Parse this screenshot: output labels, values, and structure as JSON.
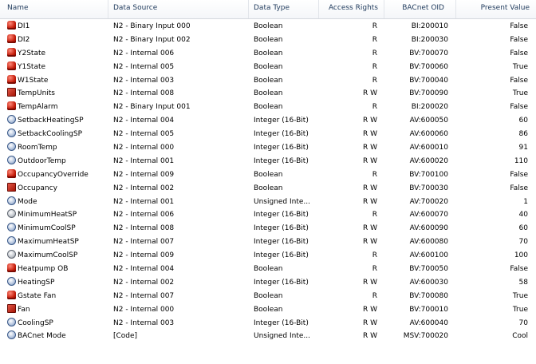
{
  "columns": {
    "name": "Name",
    "data_source": "Data Source",
    "data_type": "Data Type",
    "access_rights": "Access Rights",
    "bacnet_oid": "BACnet OID",
    "present_value": "Present Value"
  },
  "rows": [
    {
      "icon": "boolean-point-icon",
      "name": "DI1",
      "source": "N2 - Binary Input 000",
      "type": "Boolean",
      "access": "R",
      "oid": "BI:200010",
      "value": "False"
    },
    {
      "icon": "boolean-point-icon",
      "name": "DI2",
      "source": "N2 - Binary Input 002",
      "type": "Boolean",
      "access": "R",
      "oid": "BI:200030",
      "value": "False"
    },
    {
      "icon": "boolean-point-icon",
      "name": "Y2State",
      "source": "N2 - Internal 006",
      "type": "Boolean",
      "access": "R",
      "oid": "BV:700070",
      "value": "False"
    },
    {
      "icon": "boolean-point-icon",
      "name": "Y1State",
      "source": "N2 - Internal 005",
      "type": "Boolean",
      "access": "R",
      "oid": "BV:700060",
      "value": "True"
    },
    {
      "icon": "boolean-point-icon",
      "name": "W1State",
      "source": "N2 - Internal 003",
      "type": "Boolean",
      "access": "R",
      "oid": "BV:700040",
      "value": "False"
    },
    {
      "icon": "boolean-writable-icon",
      "name": "TempUnits",
      "source": "N2 - Internal 008",
      "type": "Boolean",
      "access": "RW",
      "oid": "BV:700090",
      "value": "True"
    },
    {
      "icon": "boolean-point-icon",
      "name": "TempAlarm",
      "source": "N2 - Binary Input 001",
      "type": "Boolean",
      "access": "R",
      "oid": "BI:200020",
      "value": "False"
    },
    {
      "icon": "numeric-point-icon",
      "name": "SetbackHeatingSP",
      "source": "N2 - Internal 004",
      "type": "Integer (16-Bit)",
      "access": "RW",
      "oid": "AV:600050",
      "value": "60"
    },
    {
      "icon": "numeric-point-icon",
      "name": "SetbackCoolingSP",
      "source": "N2 - Internal 005",
      "type": "Integer (16-Bit)",
      "access": "RW",
      "oid": "AV:600060",
      "value": "86"
    },
    {
      "icon": "numeric-point-icon",
      "name": "RoomTemp",
      "source": "N2 - Internal 000",
      "type": "Integer (16-Bit)",
      "access": "RW",
      "oid": "AV:600010",
      "value": "91"
    },
    {
      "icon": "numeric-point-icon",
      "name": "OutdoorTemp",
      "source": "N2 - Internal 001",
      "type": "Integer (16-Bit)",
      "access": "RW",
      "oid": "AV:600020",
      "value": "110"
    },
    {
      "icon": "boolean-point-icon",
      "name": "OccupancyOverride",
      "source": "N2 - Internal 009",
      "type": "Boolean",
      "access": "R",
      "oid": "BV:700100",
      "value": "False"
    },
    {
      "icon": "boolean-writable-icon",
      "name": "Occupancy",
      "source": "N2 - Internal 002",
      "type": "Boolean",
      "access": "RW",
      "oid": "BV:700030",
      "value": "False"
    },
    {
      "icon": "numeric-point-icon",
      "name": "Mode",
      "source": "N2 - Internal 001",
      "type": "Unsigned Inte...",
      "access": "RW",
      "oid": "AV:700020",
      "value": "1"
    },
    {
      "icon": "numeric-readonly-icon",
      "name": "MinimumHeatSP",
      "source": "N2 - Internal 006",
      "type": "Integer (16-Bit)",
      "access": "R",
      "oid": "AV:600070",
      "value": "40"
    },
    {
      "icon": "numeric-point-icon",
      "name": "MinimumCoolSP",
      "source": "N2 - Internal 008",
      "type": "Integer (16-Bit)",
      "access": "RW",
      "oid": "AV:600090",
      "value": "60"
    },
    {
      "icon": "numeric-point-icon",
      "name": "MaximumHeatSP",
      "source": "N2 - Internal 007",
      "type": "Integer (16-Bit)",
      "access": "RW",
      "oid": "AV:600080",
      "value": "70"
    },
    {
      "icon": "numeric-readonly-icon",
      "name": "MaximumCoolSP",
      "source": "N2 - Internal 009",
      "type": "Integer (16-Bit)",
      "access": "R",
      "oid": "AV:600100",
      "value": "100"
    },
    {
      "icon": "boolean-point-icon",
      "name": "Heatpump OB",
      "source": "N2 - Internal 004",
      "type": "Boolean",
      "access": "R",
      "oid": "BV:700050",
      "value": "False"
    },
    {
      "icon": "numeric-point-icon",
      "name": "HeatingSP",
      "source": "N2 - Internal 002",
      "type": "Integer (16-Bit)",
      "access": "RW",
      "oid": "AV:600030",
      "value": "58"
    },
    {
      "icon": "boolean-point-icon",
      "name": "Gstate Fan",
      "source": "N2 - Internal 007",
      "type": "Boolean",
      "access": "R",
      "oid": "BV:700080",
      "value": "True"
    },
    {
      "icon": "boolean-writable-icon",
      "name": "Fan",
      "source": "N2 - Internal 000",
      "type": "Boolean",
      "access": "RW",
      "oid": "BV:700010",
      "value": "True"
    },
    {
      "icon": "numeric-point-icon",
      "name": "CoolingSP",
      "source": "N2 - Internal 003",
      "type": "Integer (16-Bit)",
      "access": "RW",
      "oid": "AV:600040",
      "value": "70"
    },
    {
      "icon": "numeric-point-icon",
      "name": "BACnet Mode",
      "source": "[Code]",
      "type": "Unsigned Inte...",
      "access": "RW",
      "oid": "MSV:700020",
      "value": "Cool"
    }
  ]
}
